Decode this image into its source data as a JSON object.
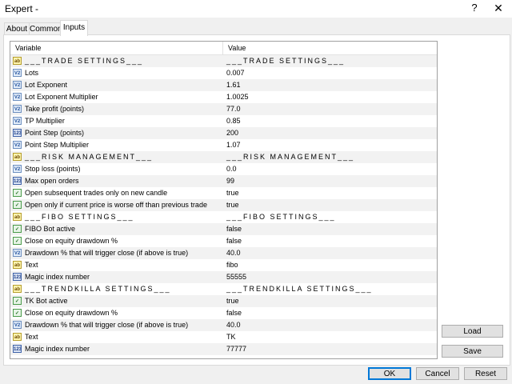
{
  "window": {
    "title": "Expert -",
    "help_glyph": "?",
    "close_glyph": "✕"
  },
  "tabs": [
    {
      "label": "About"
    },
    {
      "label": "Common"
    },
    {
      "label": "Inputs"
    }
  ],
  "grid": {
    "col_variable": "Variable",
    "col_value": "Value",
    "rows": [
      {
        "type": "ab",
        "name": "___TRADE SETTINGS___",
        "value": "___TRADE SETTINGS___",
        "section": true
      },
      {
        "type": "dbl",
        "name": "Lots",
        "value": "0.007"
      },
      {
        "type": "dbl",
        "name": "Lot Exponent",
        "value": "1.61"
      },
      {
        "type": "dbl",
        "name": "Lot Exponent Multiplier",
        "value": "1.0025"
      },
      {
        "type": "dbl",
        "name": "Take profit (points)",
        "value": "77.0"
      },
      {
        "type": "dbl",
        "name": "TP Multiplier",
        "value": "0.85"
      },
      {
        "type": "int",
        "name": "Point Step (points)",
        "value": "200"
      },
      {
        "type": "dbl",
        "name": "Point Step Multiplier",
        "value": "1.07"
      },
      {
        "type": "ab",
        "name": "___RISK MANAGEMENT___",
        "value": "___RISK MANAGEMENT___",
        "section": true
      },
      {
        "type": "dbl",
        "name": "Stop loss (points)",
        "value": "0.0"
      },
      {
        "type": "int",
        "name": "Max open orders",
        "value": "99"
      },
      {
        "type": "bool",
        "name": "Open subsequent trades only on new candle",
        "value": "true"
      },
      {
        "type": "bool",
        "name": "Open only if current price is worse off than previous trade",
        "value": "true"
      },
      {
        "type": "ab",
        "name": "___FIBO SETTINGS___",
        "value": "___FIBO SETTINGS___",
        "section": true
      },
      {
        "type": "bool",
        "name": "FIBO Bot active",
        "value": "false"
      },
      {
        "type": "bool",
        "name": "Close on equity drawdown %",
        "value": "false"
      },
      {
        "type": "dbl",
        "name": "Drawdown % that will trigger close (if above is true)",
        "value": "40.0"
      },
      {
        "type": "ab",
        "name": "Text",
        "value": "fibo"
      },
      {
        "type": "int",
        "name": "Magic index number",
        "value": "55555"
      },
      {
        "type": "ab",
        "name": "___TRENDKILLA SETTINGS___",
        "value": "___TRENDKILLA SETTINGS___",
        "section": true
      },
      {
        "type": "bool",
        "name": "TK Bot active",
        "value": "true"
      },
      {
        "type": "bool",
        "name": "Close on equity drawdown %",
        "value": "false"
      },
      {
        "type": "dbl",
        "name": "Drawdown % that will trigger close (if above is true)",
        "value": "40.0"
      },
      {
        "type": "ab",
        "name": "Text",
        "value": "TK"
      },
      {
        "type": "int",
        "name": "Magic index number",
        "value": "77777"
      }
    ]
  },
  "icon_glyphs": {
    "ab": "ab",
    "dbl": "V2",
    "int": "123",
    "bool": "✓"
  },
  "side_buttons": {
    "load": "Load",
    "save": "Save"
  },
  "footer_buttons": {
    "ok": "OK",
    "cancel": "Cancel",
    "reset": "Reset"
  }
}
